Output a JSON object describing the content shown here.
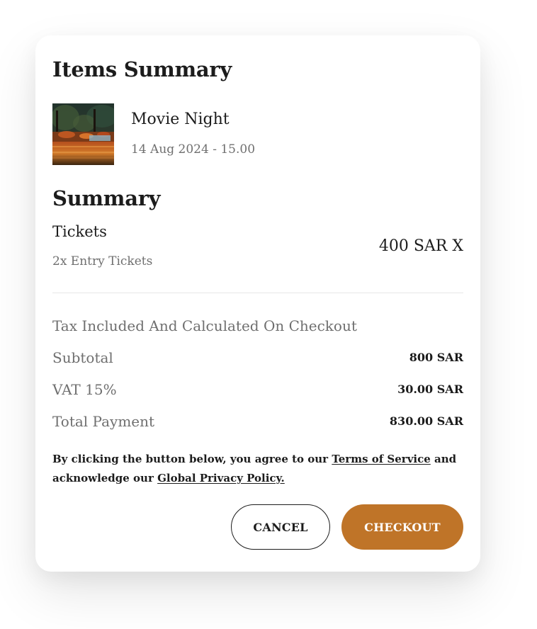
{
  "items_summary": {
    "title": "Items Summary",
    "event": {
      "name": "Movie Night",
      "date": "14 Aug 2024 - 15.00",
      "thumbnail": "movie-night-thumbnail"
    }
  },
  "summary": {
    "title": "Summary",
    "tickets": {
      "label": "Tickets",
      "description": "2x Entry Tickets",
      "price": "400 SAR X"
    },
    "tax_note": "Tax Included And Calculated On Checkout",
    "rows": [
      {
        "label": "Subtotal",
        "value": "800 SAR"
      },
      {
        "label": "VAT 15%",
        "value": "30.00 SAR"
      },
      {
        "label": "Total Payment",
        "value": "830.00 SAR"
      }
    ]
  },
  "legal": {
    "prefix": "By clicking the button below, you agree to our",
    "terms_link": "Terms of Service",
    "middle": "and acknowledge our",
    "privacy_link": "Global Privacy Policy."
  },
  "actions": {
    "cancel_label": "CANCEL",
    "checkout_label": "CHECKOUT"
  },
  "colors": {
    "accent": "#bf7428",
    "text": "#1c1c1c",
    "muted": "#6f6f6f"
  }
}
